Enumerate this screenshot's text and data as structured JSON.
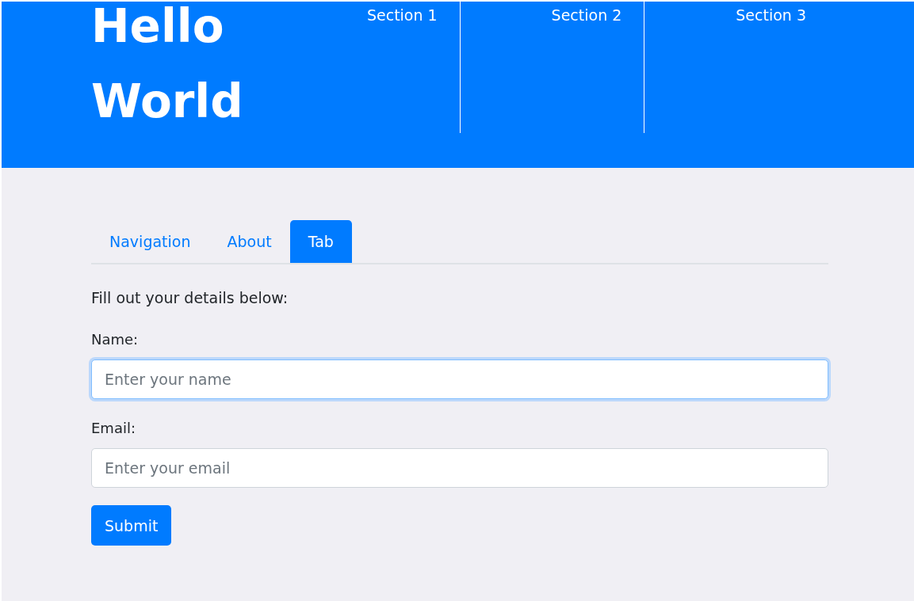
{
  "header": {
    "title_lines": [
      "Hello",
      "World"
    ],
    "sections": [
      "Section 1",
      "Section 2",
      "Section 3"
    ]
  },
  "tabs": [
    {
      "label": "Navigation",
      "selected": false
    },
    {
      "label": "About",
      "selected": false
    },
    {
      "label": "Tab",
      "selected": true
    }
  ],
  "form": {
    "intro": "Fill out your details below:",
    "fields": [
      {
        "label": "Name:",
        "placeholder": "Enter your name",
        "focused": true
      },
      {
        "label": "Email:",
        "placeholder": "Enter your email",
        "focused": false
      }
    ],
    "submit": "Submit"
  }
}
